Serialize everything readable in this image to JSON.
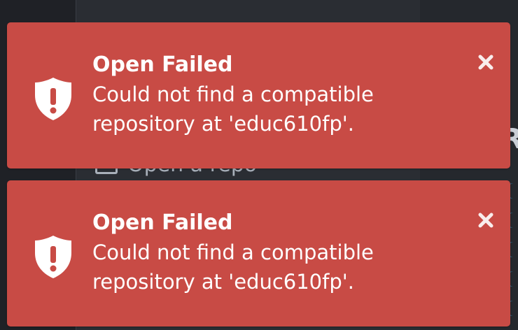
{
  "background": {
    "open_repo_label": "Open a repo",
    "right_fragment": "R"
  },
  "notifications": [
    {
      "title": "Open Failed",
      "message": "Could not find a compatible repository at 'educ610fp'.",
      "icon": "shield-warning-icon",
      "close_icon": "close-icon",
      "color": "#c84b45"
    },
    {
      "title": "Open Failed",
      "message": "Could not find a compatible repository at 'educ610fp'.",
      "icon": "shield-warning-icon",
      "close_icon": "close-icon",
      "color": "#c84b45"
    }
  ]
}
